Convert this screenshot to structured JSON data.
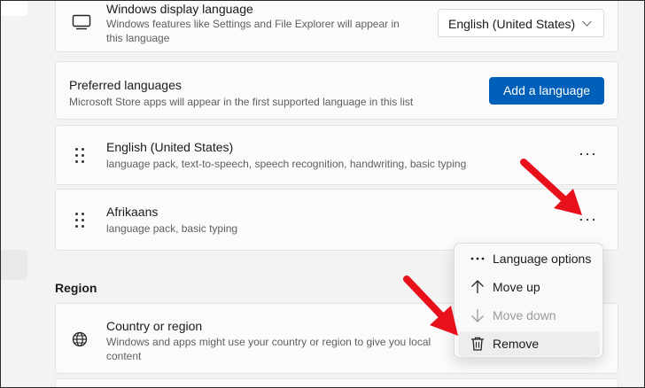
{
  "display_language": {
    "title": "Windows display language",
    "description": "Windows features like Settings and File Explorer will appear in this language",
    "selected": "English (United States)",
    "icon": "monitor-icon"
  },
  "preferred_languages": {
    "title": "Preferred languages",
    "description": "Microsoft Store apps will appear in the first supported language in this list",
    "add_button": "Add a language"
  },
  "languages": [
    {
      "name": "English (United States)",
      "features": "language pack, text-to-speech, speech recognition, handwriting, basic typing"
    },
    {
      "name": "Afrikaans",
      "features": "language pack, basic typing"
    }
  ],
  "more_label": "···",
  "region": {
    "section_title": "Region",
    "country_title": "Country or region",
    "country_description": "Windows and apps might use your country or region to give you local content",
    "icon": "globe-icon"
  },
  "context_menu": {
    "items": [
      {
        "label": "Language options",
        "icon": "more-icon",
        "enabled": true
      },
      {
        "label": "Move up",
        "icon": "arrow-up-icon",
        "enabled": true
      },
      {
        "label": "Move down",
        "icon": "arrow-down-icon",
        "enabled": false
      },
      {
        "label": "Remove",
        "icon": "trash-icon",
        "enabled": true
      }
    ]
  },
  "colors": {
    "accent": "#005fb8",
    "annotation_arrow": "#e8101a"
  }
}
